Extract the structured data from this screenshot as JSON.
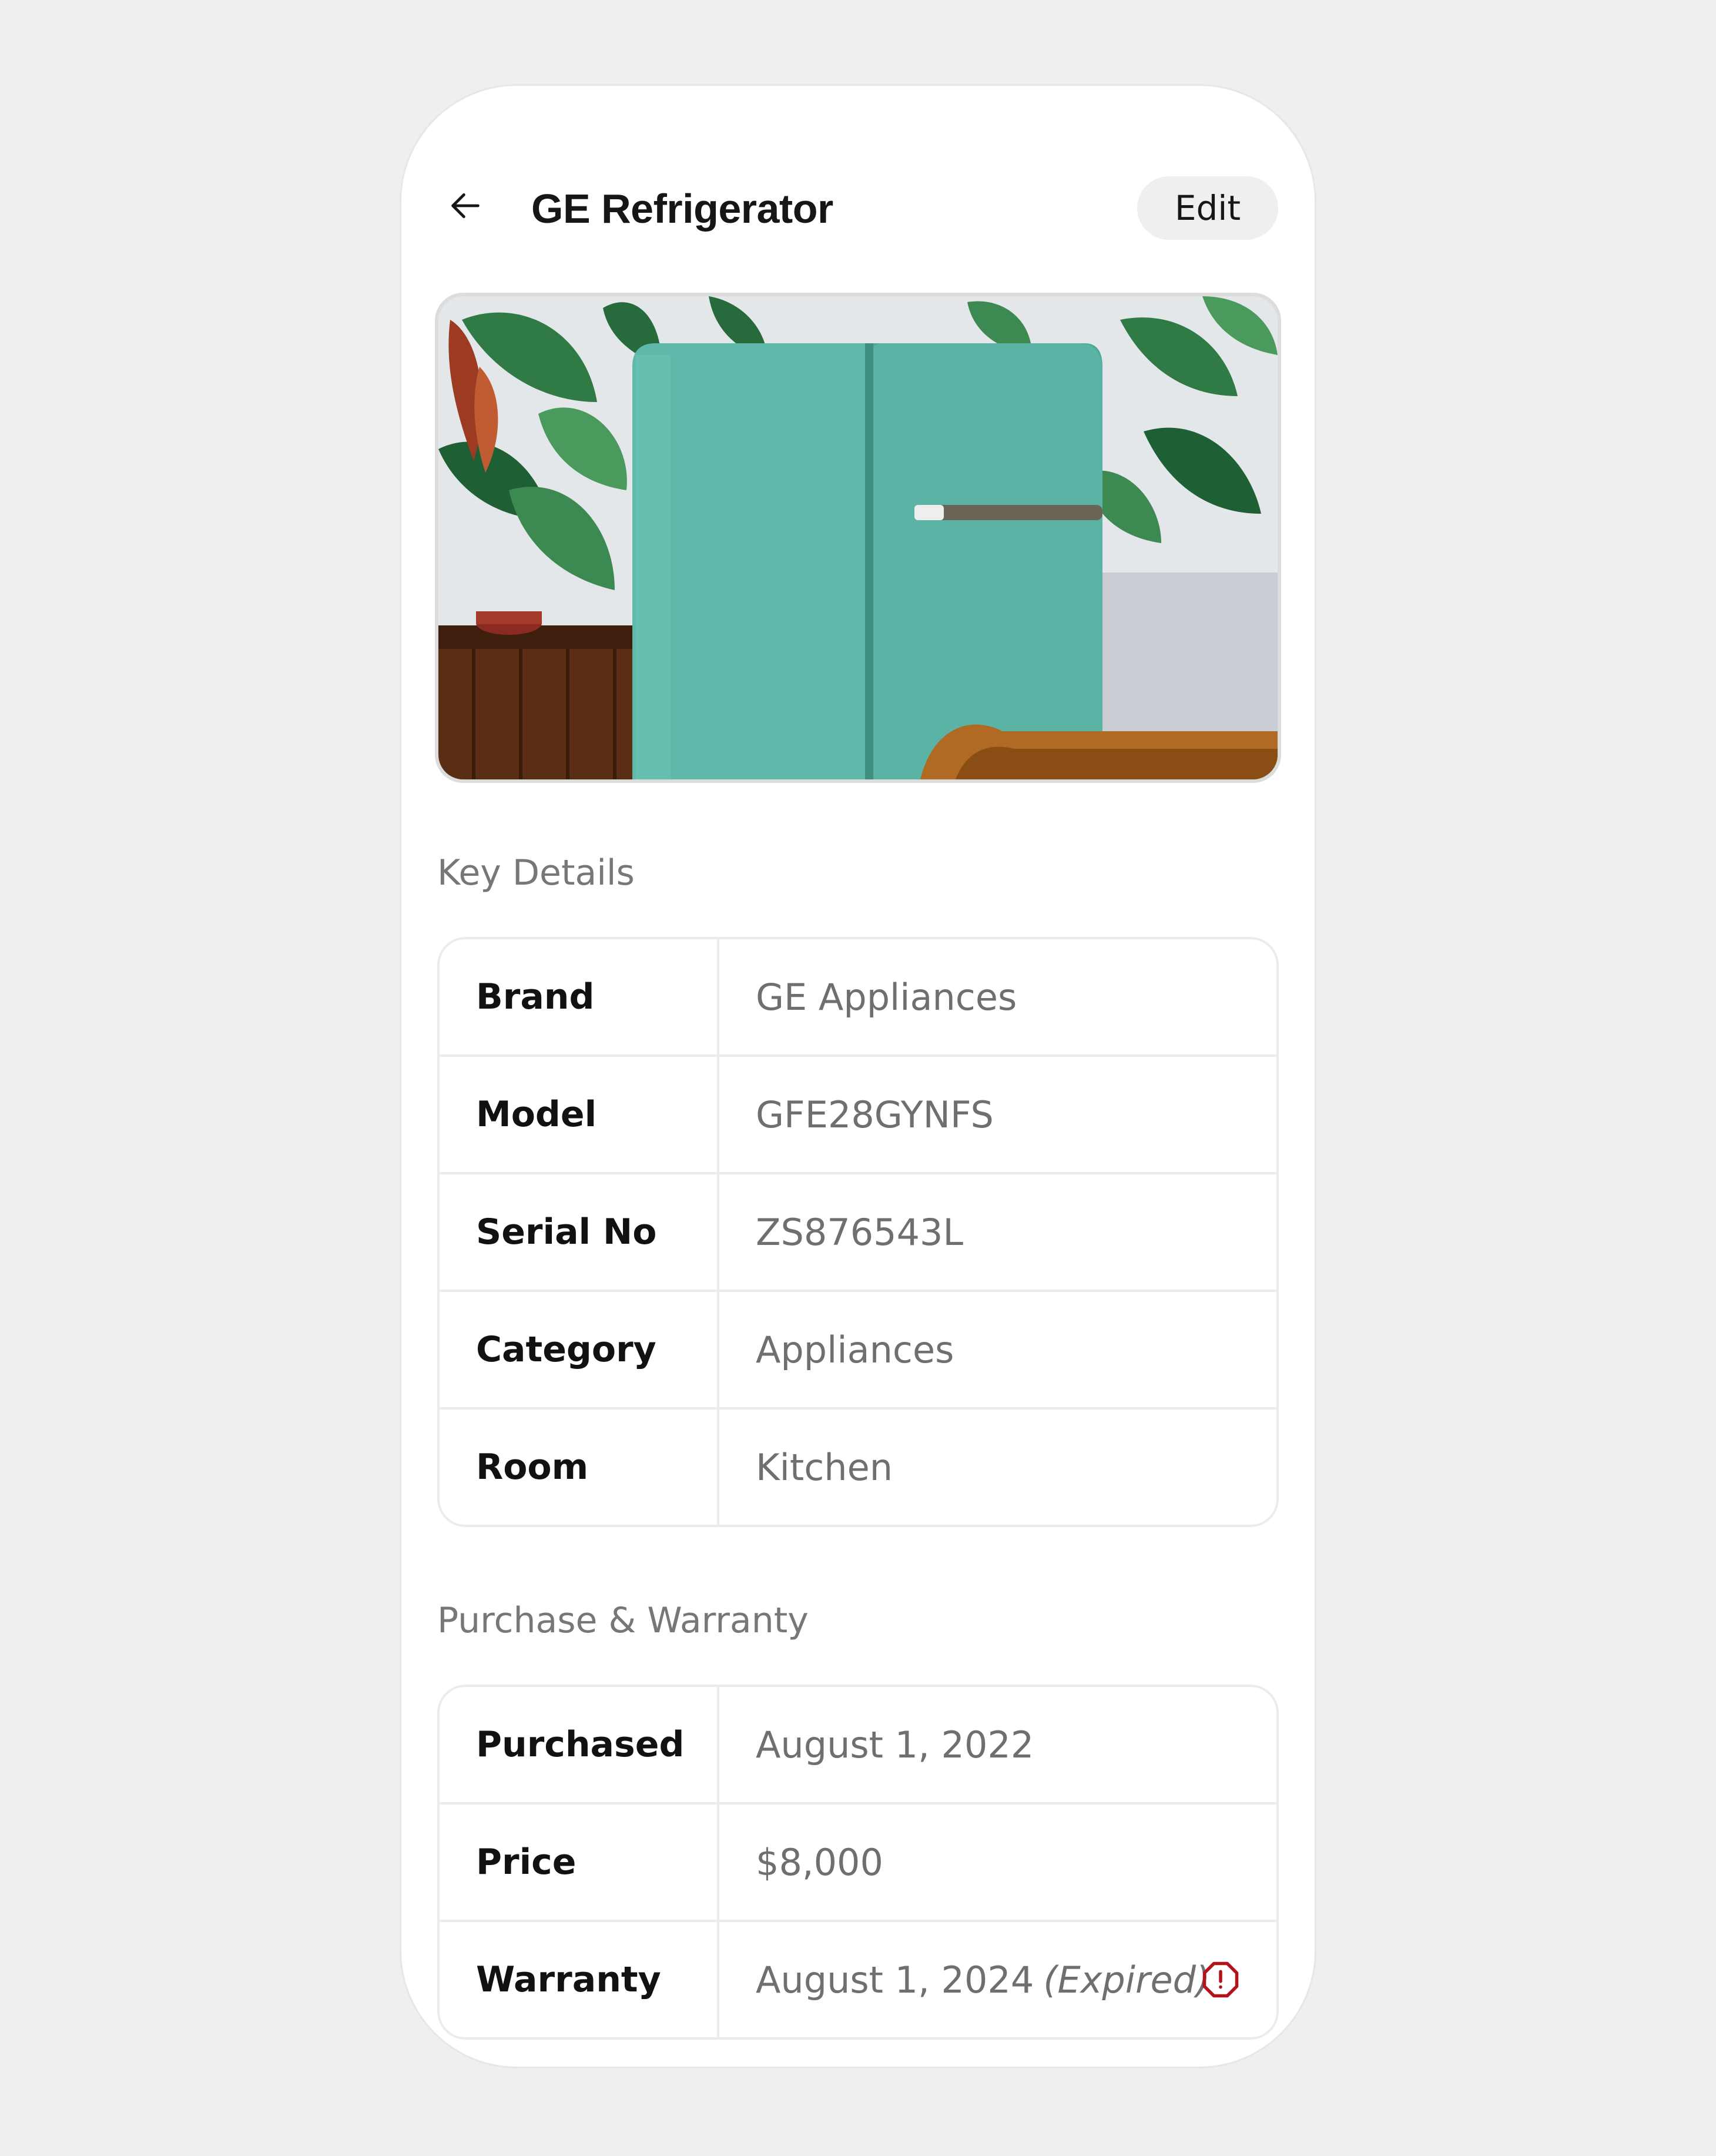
{
  "header": {
    "back_icon": "arrow-left-icon",
    "title": "GE Refrigerator",
    "edit_label": "Edit"
  },
  "photo": {
    "subject": "teal-refrigerator-photo"
  },
  "key_details": {
    "title": "Key Details",
    "rows": [
      {
        "label": "Brand",
        "value": "GE Appliances"
      },
      {
        "label": "Model",
        "value": "GFE28GYNFS"
      },
      {
        "label": "Serial No",
        "value": "ZS876543L"
      },
      {
        "label": "Category",
        "value": "Appliances"
      },
      {
        "label": "Room",
        "value": "Kitchen"
      }
    ]
  },
  "purchase_warranty": {
    "title": "Purchase & Warranty",
    "rows": [
      {
        "label": "Purchased",
        "value": "August 1, 2022"
      },
      {
        "label": "Price",
        "value": "$8,000"
      },
      {
        "label": "Warranty",
        "value": "August 1, 2024",
        "status": "(Expired)",
        "status_icon": "alert-octagon-icon"
      }
    ]
  },
  "colors": {
    "background": "#efefef",
    "card": "#ffffff",
    "warning": "#b3141b",
    "fridge": "#5fb8a9"
  }
}
